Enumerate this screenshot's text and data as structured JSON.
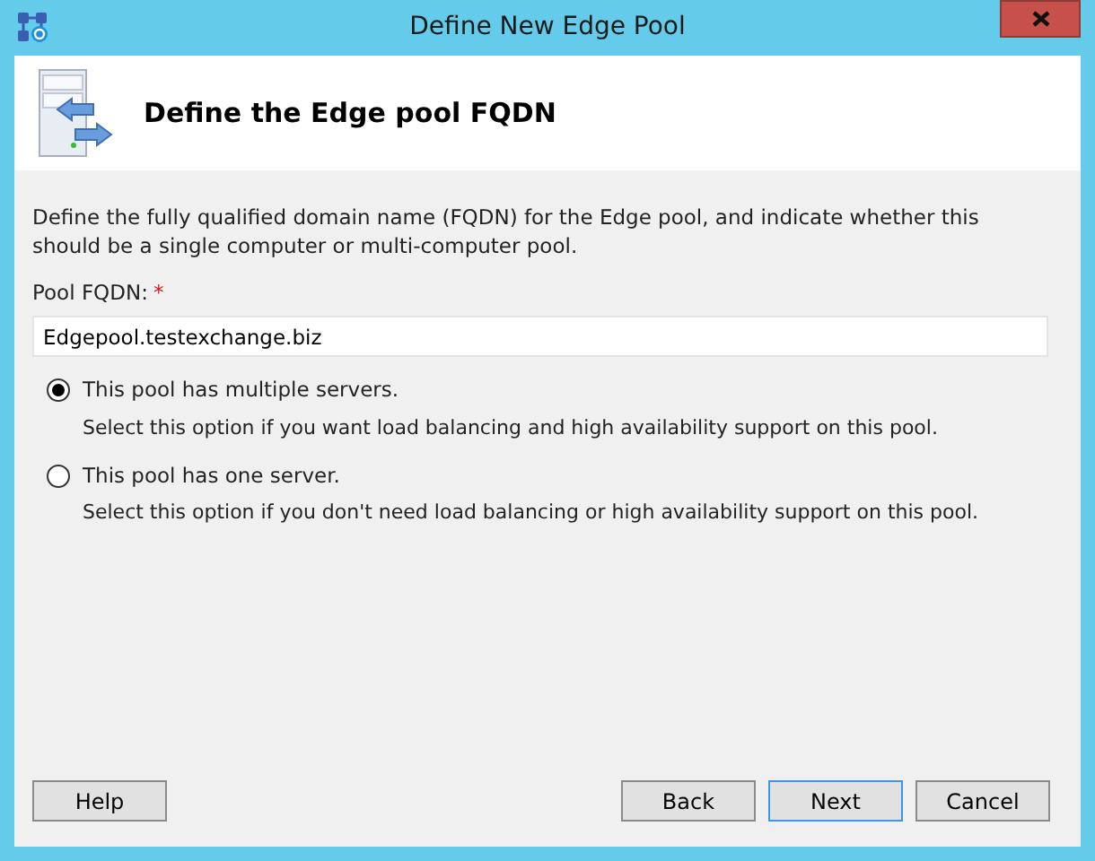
{
  "window": {
    "title": "Define New Edge Pool"
  },
  "header": {
    "title": "Define the Edge pool FQDN"
  },
  "description": "Define the fully qualified domain name (FQDN) for the Edge pool, and indicate whether this should be a single computer or multi-computer pool.",
  "fqdn_field": {
    "label": "Pool FQDN:",
    "required_mark": "*",
    "value": "Edgepool.testexchange.biz"
  },
  "options": [
    {
      "label": "This pool has multiple servers.",
      "hint": "Select this option if you want load balancing and high availability support on this pool.",
      "selected": true
    },
    {
      "label": "This pool has one server.",
      "hint": "Select this option if you don't need load balancing or high availability support on this pool.",
      "selected": false
    }
  ],
  "buttons": [
    {
      "label": "Help",
      "focused": false
    },
    {
      "label": "Back",
      "focused": false
    },
    {
      "label": "Next",
      "focused": true
    },
    {
      "label": "Cancel",
      "focused": false
    }
  ]
}
